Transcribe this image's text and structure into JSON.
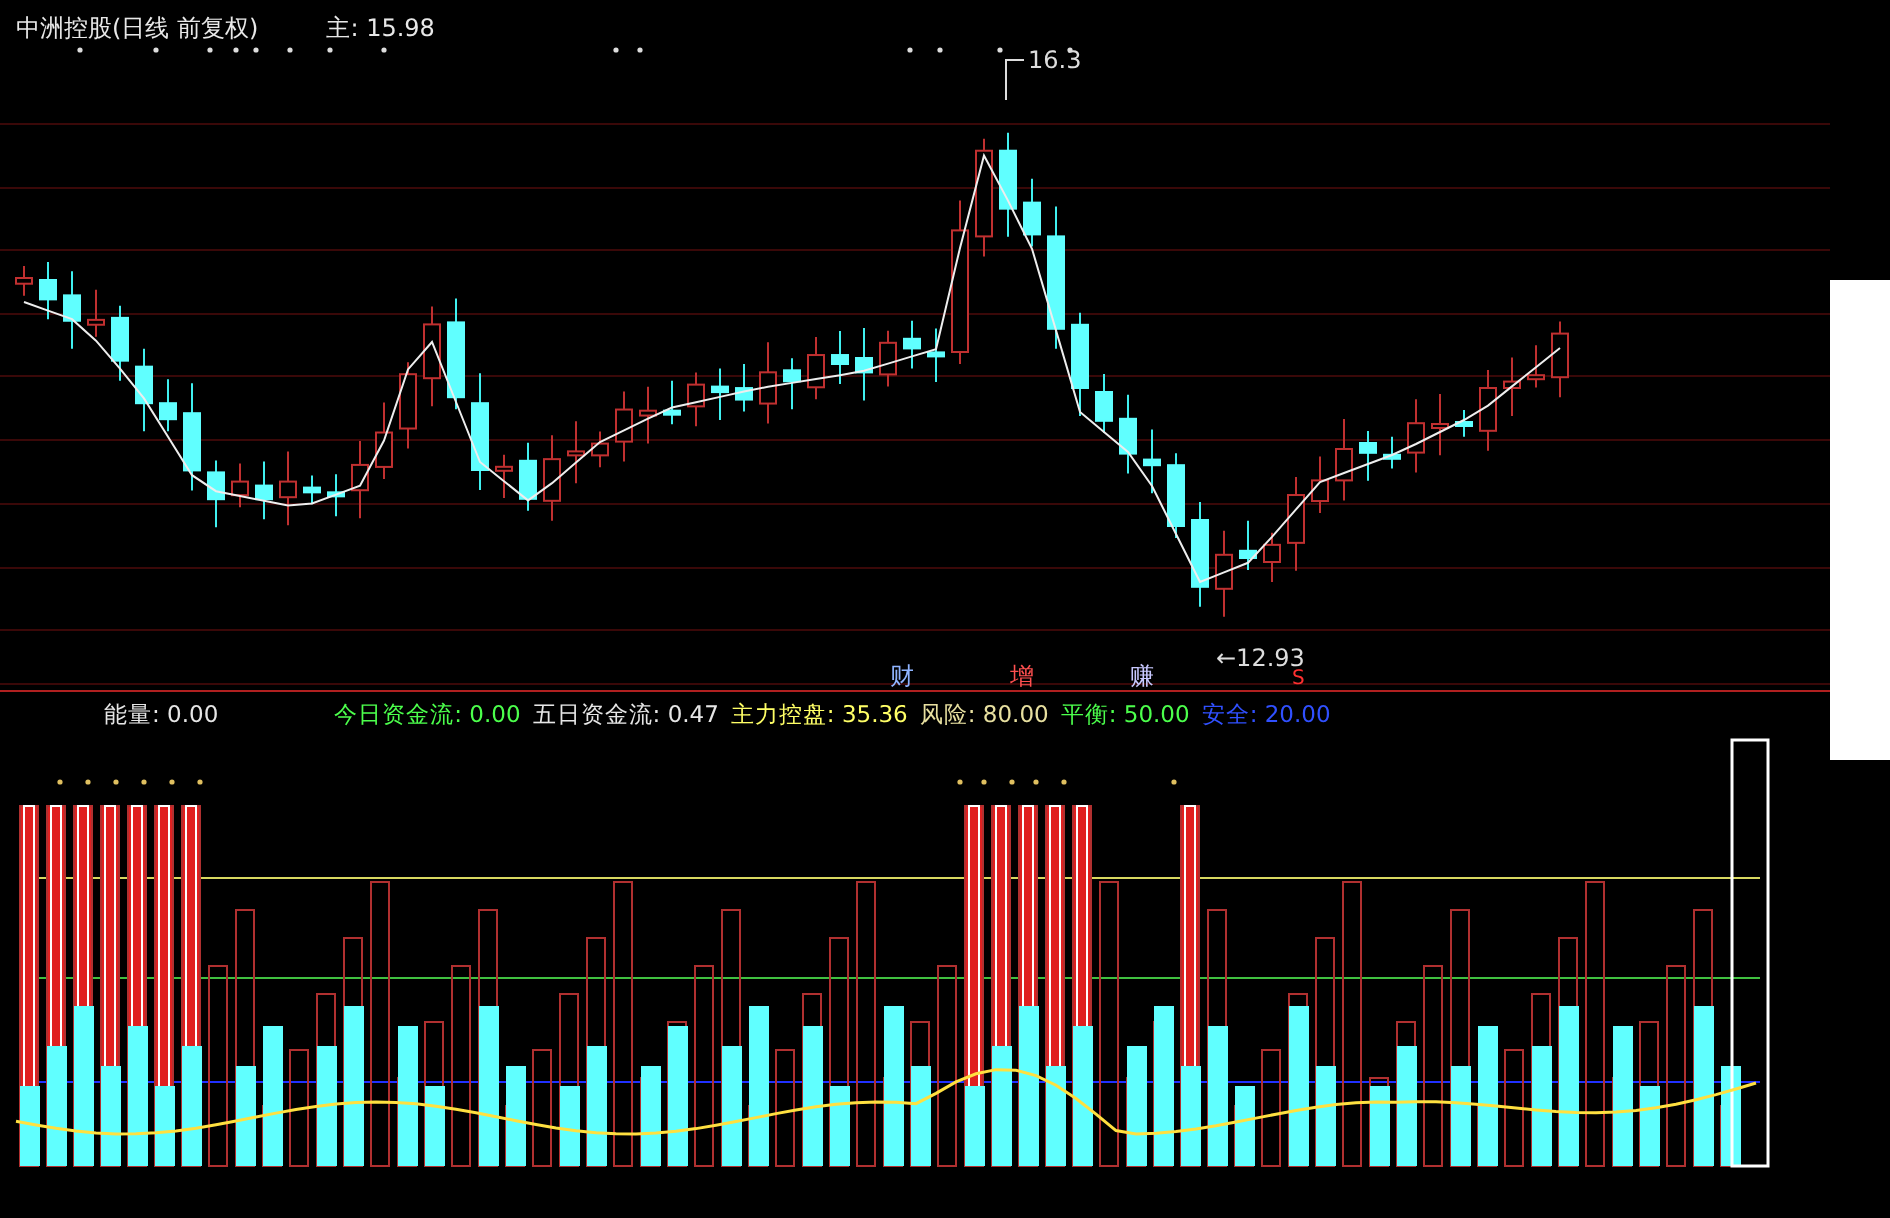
{
  "header": {
    "title": "中洲控股(日线 前复权)",
    "main_label": "主:",
    "main_value": "15.98"
  },
  "price_chart": {
    "high_label": "16.3",
    "low_label": "←12.93",
    "marker": "S",
    "signals": [
      {
        "text": "财",
        "color": "#8fb4ff"
      },
      {
        "text": "增",
        "color": "#ff5050"
      },
      {
        "text": "赚",
        "color": "#c8c8ff"
      }
    ]
  },
  "indicators": [
    {
      "label": "能量:",
      "value": "0.00",
      "color": "#e6e6e6"
    },
    {
      "label": "今日资金流:",
      "value": "0.00",
      "color": "#4cff4c"
    },
    {
      "label": "五日资金流:",
      "value": "0.47",
      "color": "#e6e6e6"
    },
    {
      "label": "主力控盘:",
      "value": "35.36",
      "color": "#ffff66"
    },
    {
      "label": "风险:",
      "value": "80.00",
      "color": "#e8e0a0"
    },
    {
      "label": "平衡:",
      "value": "50.00",
      "color": "#4cff4c"
    },
    {
      "label": "安全:",
      "value": "20.00",
      "color": "#3050ff"
    }
  ]
}
